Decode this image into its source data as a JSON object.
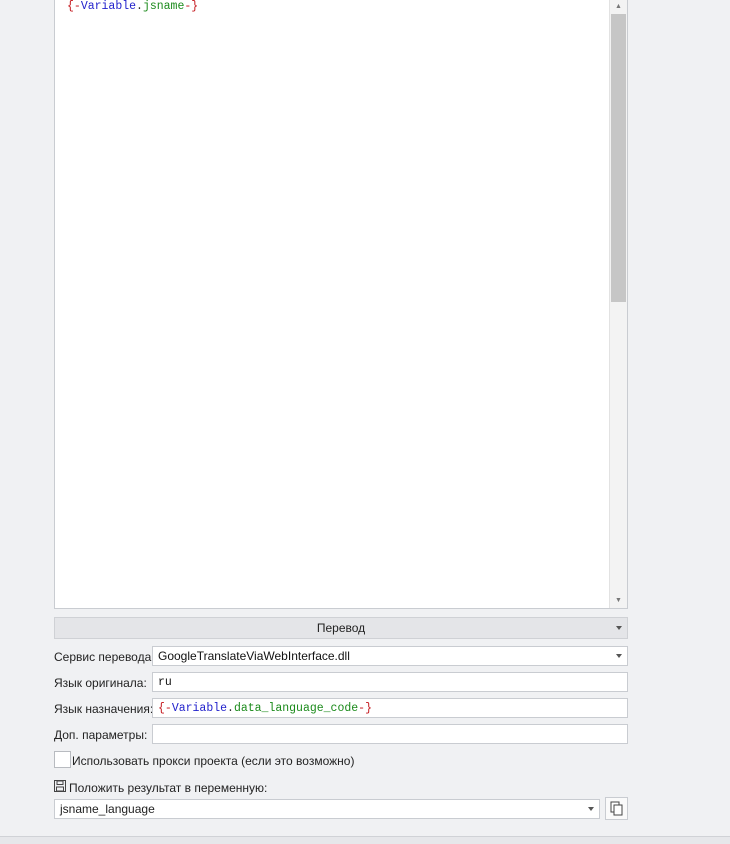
{
  "editor": {
    "brace_open": "{-",
    "keyword": "Variable",
    "dot": ".",
    "identifier": "jsname",
    "brace_close": "-}"
  },
  "section": {
    "title": "Перевод"
  },
  "fields": {
    "service_label": "Сервис перевода:",
    "service_value": "GoogleTranslateViaWebInterface.dll",
    "source_lang_label": "Язык оригинала:",
    "source_lang_value": "ru",
    "target_lang_label": "Язык назначения:",
    "target_brace_open": "{-",
    "target_keyword": "Variable",
    "target_dot": ".",
    "target_identifier": "data_language_code",
    "target_brace_close": "-}",
    "extra_params_label": "Доп. параметры:",
    "extra_params_value": ""
  },
  "proxy_checkbox": {
    "label": "Использовать прокси проекта (если это возможно)",
    "checked": false
  },
  "result": {
    "label": "Положить результат в переменную:",
    "value": "jsname_language"
  }
}
